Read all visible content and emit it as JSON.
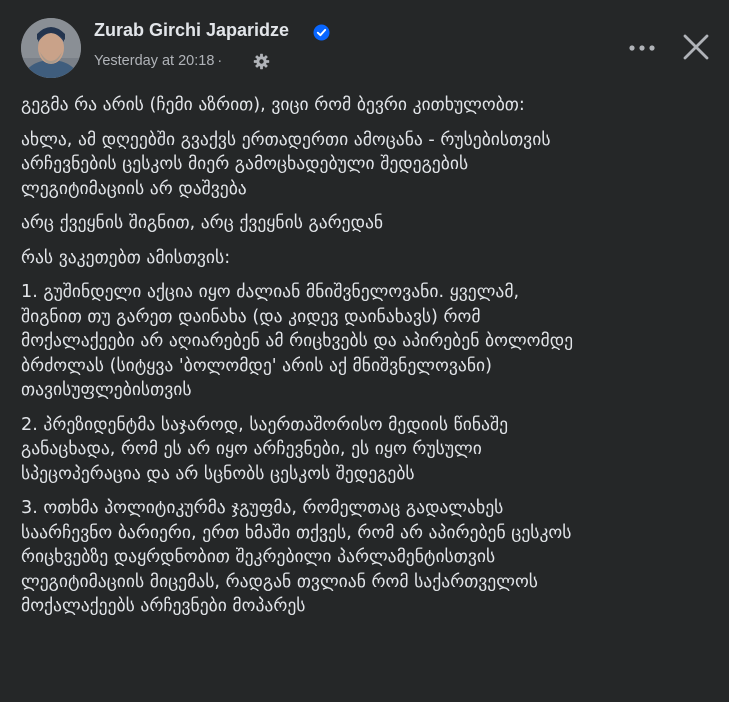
{
  "post": {
    "author": "Zurab Girchi Japaridze",
    "timestamp": "Yesterday at 20:18",
    "separator": "·",
    "paragraphs": [
      [
        "გეგმა რა არის (ჩემი აზრით), ვიცი რომ ბევრი კითხულობთ:"
      ],
      [
        "ახლა, ამ დღეებში გვაქვს ერთადერთი ამოცანა - რუსებისთვის",
        "არჩევნების ცესკოს მიერ გამოცხადებული შედეგების",
        "ლეგიტიმაციის არ დაშვება"
      ],
      [
        "არც ქვეყნის შიგნით, არც ქვეყნის გარედან"
      ],
      [
        "რას ვაკეთებთ ამისთვის:"
      ],
      [
        "1. გუშინდელი აქცია იყო ძალიან მნიშვნელოვანი. ყველამ,",
        "შიგნით თუ გარეთ დაინახა (და კიდევ დაინახავს) რომ",
        "მოქალაქეები არ აღიარებენ ამ რიცხვებს და აპირებენ ბოლომდე",
        "ბრძოლას (სიტყვა 'ბოლომდე' არის აქ მნიშვნელოვანი)",
        "თავისუფლებისთვის"
      ],
      [
        "2. პრეზიდენტმა საჯაროდ, საერთაშორისო მედიის წინაშე",
        "განაცხადა, რომ ეს არ იყო არჩევნები, ეს იყო რუსული",
        "სპეცოპერაცია და არ სცნობს ცესკოს შედეგებს"
      ],
      [
        "3. ოთხმა პოლიტიკურმა ჯგუფმა, რომელთაც გადალახეს",
        "საარჩევნო ბარიერი, ერთ ხმაში თქვეს, რომ არ აპირებენ ცესკოს",
        "რიცხვებზე დაყრდნობით შეკრებილი პარლამენტისთვის",
        "ლეგიტიმაციის მიცემას, რადგან თვლიან რომ საქართველოს",
        "მოქალაქეებს არჩევნები მოპარეს"
      ]
    ]
  },
  "colors": {
    "background": "#252728",
    "text_primary": "#e2e5e9",
    "text_secondary": "#b0b3b8",
    "verified_badge": "#0866ff"
  },
  "icons": {
    "verified": "verified-badge-icon",
    "audience": "gear-icon",
    "more": "more-options-icon",
    "close": "close-icon"
  }
}
